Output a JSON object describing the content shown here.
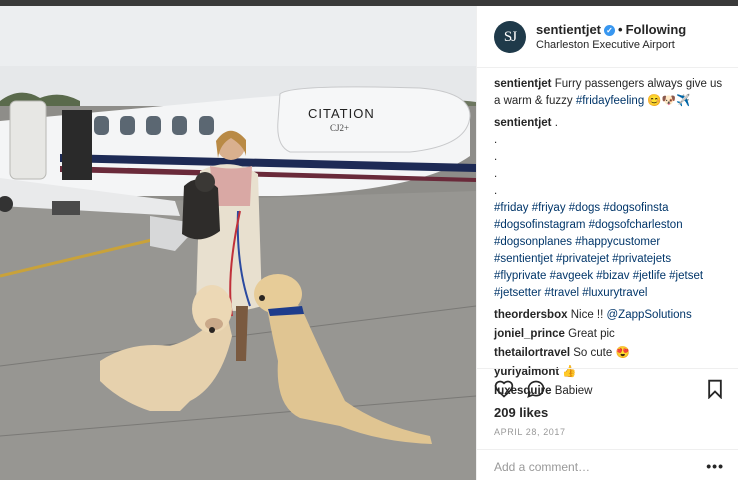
{
  "post": {
    "avatar_text": "SJ",
    "username": "sentientjet",
    "verified_mark": "✓",
    "separator": "•",
    "follow_status": "Following",
    "location": "Charleston Executive Airport"
  },
  "photo": {
    "aircraft_lettering": "CITATION",
    "aircraft_lettering_2": "CJ2+"
  },
  "caption": {
    "user": "sentientjet",
    "text": "Furry passengers always give us a warm & fuzzy ",
    "hashtag": "#fridayfeeling",
    "emoji": "😊🐶✈️",
    "second_user": "sentientjet",
    "second_text": ".",
    "dots": [
      ".",
      ".",
      ".",
      "."
    ],
    "hashtag_lines": [
      "#friday #friyay #dogs #dogsofinsta",
      "#dogsofinstagram #dogsofcharleston",
      "#dogsonplanes #happycustomer",
      "#sentientjet #privatejet #privatejets",
      "#flyprivate #avgeek #bizav #jetlife #jetset",
      "#jetsetter #travel #luxurytravel"
    ]
  },
  "comments": [
    {
      "user": "theordersbox",
      "text": "Nice !! ",
      "mention": "@ZappSolutions"
    },
    {
      "user": "joniel_prince",
      "text": "Great pic",
      "mention": ""
    },
    {
      "user": "thetailortravel",
      "text": "So cute 😍",
      "mention": ""
    },
    {
      "user": "yuriyalmont",
      "text": "👍",
      "mention": ""
    },
    {
      "user": "luxesquire",
      "text": "Babiew",
      "mention": ""
    }
  ],
  "actions": {
    "likes": "209 likes",
    "date": "APRIL 28, 2017",
    "add_comment_placeholder": "Add a comment…",
    "more_label": "•••",
    "icons": [
      "heart-icon",
      "comment-icon",
      "bookmark-icon"
    ]
  },
  "colors": {
    "link": "#003569",
    "verified": "#3897f0",
    "muted": "#999999"
  }
}
